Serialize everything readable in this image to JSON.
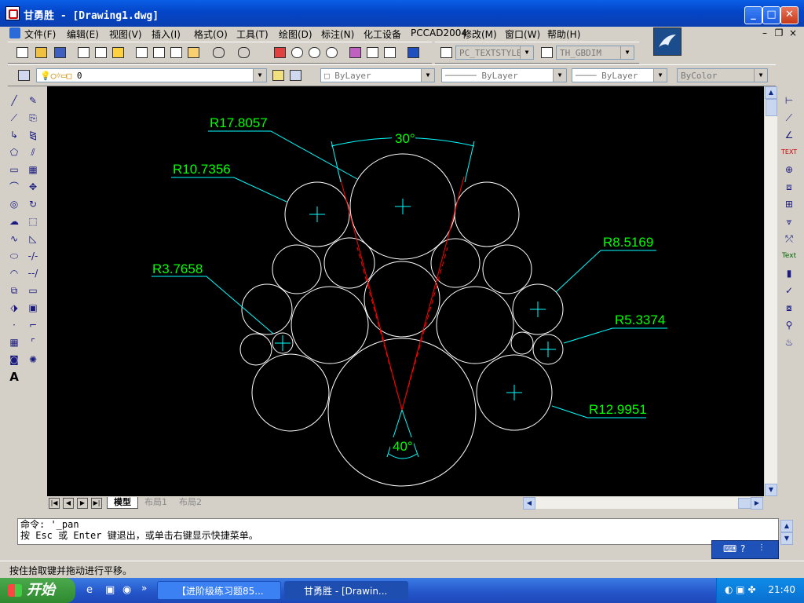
{
  "window": {
    "title": "甘勇胜 - [Drawing1.dwg]",
    "minimize": "_",
    "maximize": "□",
    "close": "✕"
  },
  "menu": [
    "文件(F)",
    "编辑(E)",
    "视图(V)",
    "插入(I)",
    "格式(O)",
    "工具(T)",
    "绘图(D)",
    "标注(N)",
    "化工设备",
    "PCCAD2004",
    "修改(M)",
    "窗口(W)",
    "帮助(H)"
  ],
  "toolbar": {
    "textstyle": "PC_TEXTSTYLE",
    "dimstyle": "TH_GBDIM",
    "layer": "0",
    "color": "ByLayer",
    "linetype": "ByLayer",
    "lineweight": "ByLayer",
    "plotstyle": "ByColor"
  },
  "tabs": [
    "模型",
    "布局1",
    "布局2"
  ],
  "command_lines": [
    "命令: '_pan",
    "按 Esc 或 Enter 键退出，或单击右键显示快捷菜单。"
  ],
  "status_text": "按住拾取键并拖动进行平移。",
  "taskbar": {
    "start": "开始",
    "tasks": [
      "【进阶级练习题85...",
      "甘勇胜 - [Drawin..."
    ],
    "clock": "21:40"
  },
  "drawing": {
    "dims": {
      "r1": "R17.8057",
      "r2": "R10.7356",
      "r3": "R3.7658",
      "r4": "R8.5169",
      "r5": "R5.3374",
      "r6": "R12.9951",
      "a1": "30°",
      "a2": "40°"
    },
    "colors": {
      "geometry": "#ffffff",
      "dimension": "#00ff00",
      "leader": "#00ffff",
      "construction": "#ff0000"
    }
  }
}
